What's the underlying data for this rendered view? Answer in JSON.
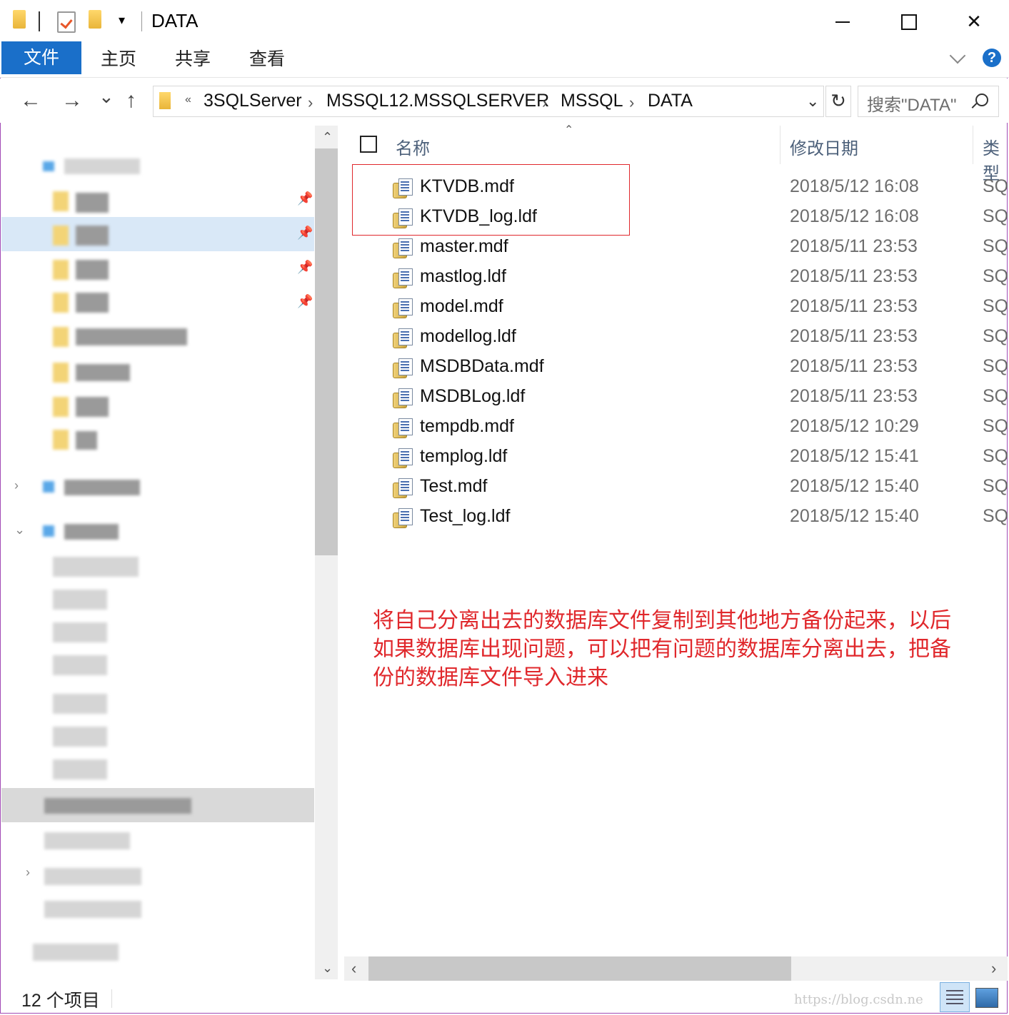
{
  "window": {
    "title": "DATA",
    "controls": {
      "minimize": "—",
      "maximize": "☐",
      "close": "✕"
    }
  },
  "ribbon": {
    "tabs": [
      "文件",
      "主页",
      "共享",
      "查看"
    ],
    "help": "?"
  },
  "navigation": {
    "back": "←",
    "forward": "→",
    "recent": "⌄",
    "up": "↑"
  },
  "address": {
    "more": "«",
    "breadcrumbs": [
      "3SQLServer",
      "MSSQL12.MSSQLSERVER",
      "MSSQL",
      "DATA"
    ],
    "separator": "›",
    "dropdown": "⌄",
    "refresh": "↻"
  },
  "search": {
    "placeholder": "搜索\"DATA\""
  },
  "columns": {
    "name": "名称",
    "date": "修改日期",
    "type": "类型"
  },
  "files": [
    {
      "name": "KTVDB.mdf",
      "date": "2018/5/12 16:08",
      "type": "SQ"
    },
    {
      "name": "KTVDB_log.ldf",
      "date": "2018/5/12 16:08",
      "type": "SQ"
    },
    {
      "name": "master.mdf",
      "date": "2018/5/11 23:53",
      "type": "SQ"
    },
    {
      "name": "mastlog.ldf",
      "date": "2018/5/11 23:53",
      "type": "SQ"
    },
    {
      "name": "model.mdf",
      "date": "2018/5/11 23:53",
      "type": "SQ"
    },
    {
      "name": "modellog.ldf",
      "date": "2018/5/11 23:53",
      "type": "SQ"
    },
    {
      "name": "MSDBData.mdf",
      "date": "2018/5/11 23:53",
      "type": "SQ"
    },
    {
      "name": "MSDBLog.ldf",
      "date": "2018/5/11 23:53",
      "type": "SQ"
    },
    {
      "name": "tempdb.mdf",
      "date": "2018/5/12 10:29",
      "type": "SQ"
    },
    {
      "name": "templog.ldf",
      "date": "2018/5/12 15:41",
      "type": "SQ"
    },
    {
      "name": "Test.mdf",
      "date": "2018/5/12 15:40",
      "type": "SQ"
    },
    {
      "name": "Test_log.ldf",
      "date": "2018/5/12 15:40",
      "type": "SQ"
    }
  ],
  "annotation": {
    "lines": [
      "将自己分离出去的数据库文件复制到其他地方备份起来，以后",
      "如果数据库出现问题，可以把有问题的数据库分离出去，把备",
      "份的数据库文件导入进来"
    ],
    "color": "#e0282c"
  },
  "status": {
    "item_count": "12 个项目"
  },
  "watermark": "https://blog.csdn.ne",
  "colors": {
    "accent": "#1a6fc9",
    "highlight_border": "#e0282c",
    "frame": "#a24bb5"
  }
}
